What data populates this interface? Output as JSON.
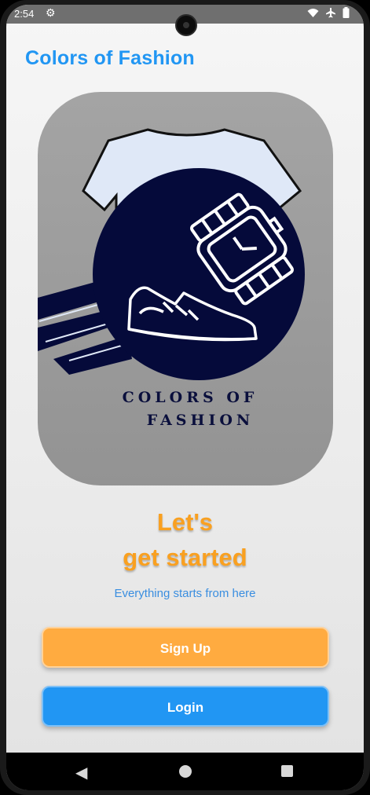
{
  "status_bar": {
    "time": "2:54",
    "icons": [
      "settings-icon",
      "wifi-icon",
      "airplane-icon",
      "battery-icon"
    ]
  },
  "app": {
    "title": "Colors of Fashion"
  },
  "logo": {
    "text_line1": "COLORS OF",
    "text_line2": "FASHION",
    "colors": {
      "navy": "#050a3a",
      "shirt": "#dfe8f7"
    }
  },
  "hero": {
    "heading_line1": "Let's",
    "heading_line2": "get started",
    "subtitle": "Everything starts from here"
  },
  "buttons": {
    "signup_label": "Sign Up",
    "login_label": "Login"
  },
  "colors": {
    "accent_blue": "#2196f3",
    "accent_orange": "#ffab40",
    "heading_orange": "#f9a020"
  },
  "nav_bar": {
    "icons": [
      "back-icon",
      "home-icon",
      "recents-icon"
    ]
  }
}
